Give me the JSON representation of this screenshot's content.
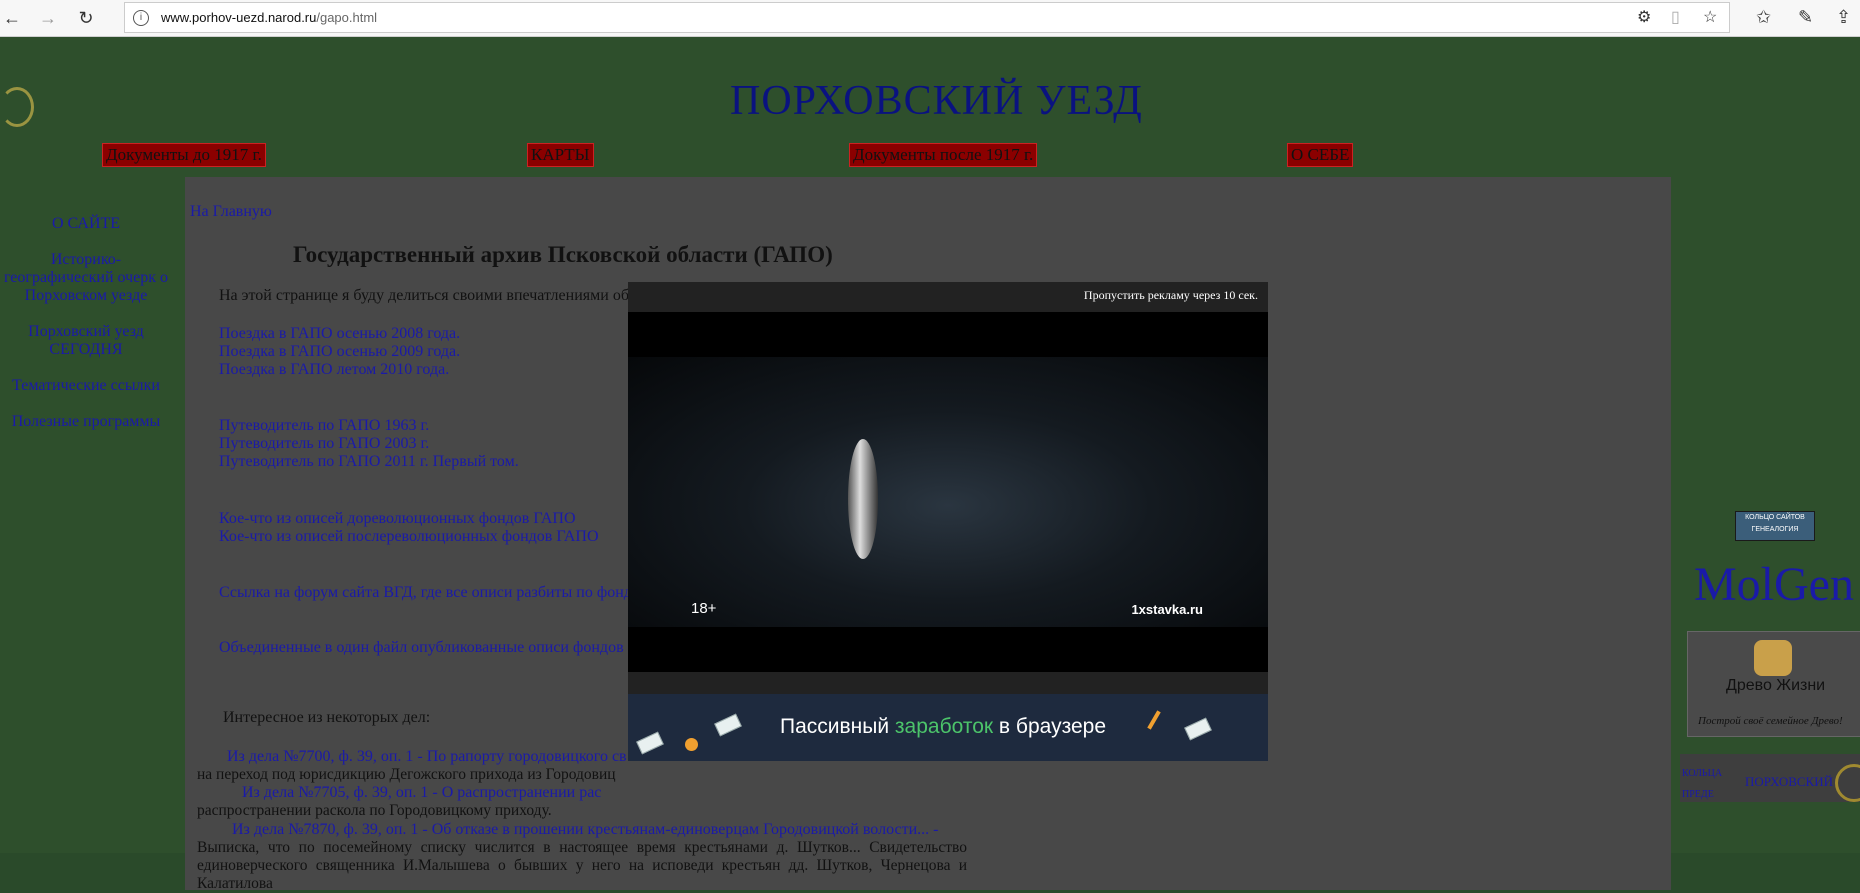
{
  "browser": {
    "url_host": "www.porhov-uezd.narod.ru",
    "url_path": "/gapo.html"
  },
  "site": {
    "title": "ПОРХОВСКИЙ УЕЗД",
    "top_nav": [
      "Документы до 1917 г.",
      "КАРТЫ",
      "Документы после 1917 г.",
      "О СЕБЕ"
    ]
  },
  "left_nav": [
    "О САЙТЕ",
    "Историко-географический очерк о Порховском уезде",
    "Порховский уезд СЕГОДНЯ",
    "Тематические ссылки",
    "Полезные программы"
  ],
  "content": {
    "main_link": "На Главную",
    "title": "Государственный архив Псковской области (ГАПО)",
    "intro": "На этой странице я буду делиться своими впечатлениями об архиве и своими находками в нем.",
    "trips": [
      "Поездка в ГАПО осенью 2008 года.",
      "Поездка в ГАПО осенью 2009 года.",
      "Поездка в ГАПО летом 2010 года."
    ],
    "guides": [
      "Путеводитель по ГАПО 1963 г.",
      "Путеводитель по ГАПО 2003 г.",
      "Путеводитель по ГАПО 2011 г. Первый том."
    ],
    "inventories": [
      "Кое-что из описей дореволюционных фондов ГАПО",
      "Кое-что из описей послереволюционных фондов ГАПО"
    ],
    "forum_link": "Ссылка на форум сайта ВГД, где все описи разбиты по фонд",
    "merged_link": "Объединенные в один файл опубликованные описи фондов",
    "interesting": "Интересное из некоторых дел:",
    "case1_link": "Из дела №7700, ф. 39, оп. 1 - По рапорту городовицкого св",
    "case1_text": "на переход под юрисдикцию Дегожского прихода из Городовиц",
    "case2_link": "Из дела №7705, ф. 39, оп. 1 - О распространении рас",
    "case2_text": "распространении раскола по Городовицкому приходу.",
    "case3_link": "Из дела №7870, ф. 39, оп. 1 - Об отказе в прошении крестьянам-единоверцам Городовицкой волости... -",
    "case3_text": "Выписка, что по посемейному списку числится в настоящее время крестьянами д. Шутков... Свидетельство единоверческого священника И.Малышева о бывших у него на исповеди крестьян дд. Шутков, Чернецова и Калатилова"
  },
  "sidebar_right": {
    "ring_line1": "КОЛЬЦО САЙТОВ",
    "ring_line2": "ГЕНЕАЛОГИЯ",
    "molgen": "MolGen",
    "drevo_title": "Древо Жизни",
    "drevo_sub": "Построй своё семейное Древо!",
    "porh_a": "КОЛЬЦА",
    "porh_b": "ПРЕДЕ",
    "porh_c": "ПОРХОВСКИЙ"
  },
  "ad": {
    "skip": "Пропустить рекламу через 10 сек.",
    "age": "18+",
    "brand": "1xstavka.ru",
    "banner_pre": "Пассивный ",
    "banner_accent": "заработок",
    "banner_post": " в браузере"
  }
}
